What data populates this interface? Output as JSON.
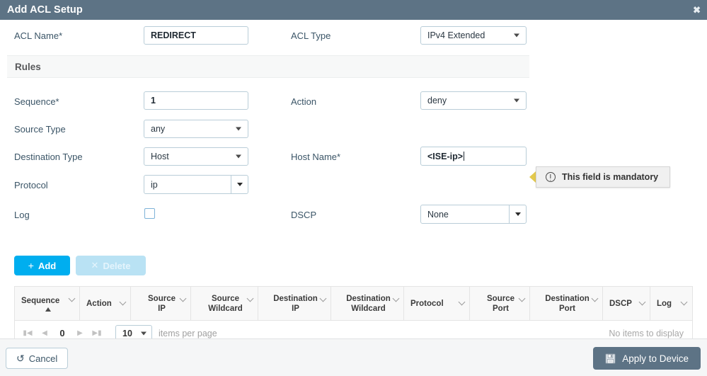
{
  "window": {
    "title": "Add ACL Setup",
    "close_icon": "close-icon"
  },
  "form": {
    "acl_name_label": "ACL Name*",
    "acl_name_value": "REDIRECT",
    "acl_type_label": "ACL Type",
    "acl_type_value": "IPv4 Extended",
    "rules_section_title": "Rules",
    "sequence_label": "Sequence*",
    "sequence_value": "1",
    "action_label": "Action",
    "action_value": "deny",
    "source_type_label": "Source Type",
    "source_type_value": "any",
    "destination_type_label": "Destination Type",
    "destination_type_value": "Host",
    "host_name_label": "Host Name*",
    "host_name_value": "<ISE-ip>",
    "protocol_label": "Protocol",
    "protocol_value": "ip",
    "log_label": "Log",
    "log_checked": false,
    "dscp_label": "DSCP",
    "dscp_value": "None"
  },
  "validation": {
    "message": "This field is mandatory",
    "icon": "exclamation-circle-icon",
    "pointer_color": "#e3c94e"
  },
  "rule_actions": {
    "add_label": "Add",
    "add_icon": "plus-icon",
    "delete_label": "Delete",
    "delete_icon": "close-x-icon",
    "delete_disabled": true
  },
  "grid": {
    "columns": [
      {
        "label": "Sequence",
        "lines": [
          "Sequence"
        ],
        "sorted": "asc",
        "width": 92
      },
      {
        "label": "Action",
        "lines": [
          "Action"
        ],
        "sorted": "none",
        "width": 72
      },
      {
        "label": "Source IP",
        "lines": [
          "Source",
          "IP"
        ],
        "sorted": "none",
        "width": 85
      },
      {
        "label": "Source Wildcard",
        "lines": [
          "Source",
          "Wildcard"
        ],
        "sorted": "none",
        "width": 95
      },
      {
        "label": "Destination IP",
        "lines": [
          "Destination",
          "IP"
        ],
        "sorted": "none",
        "width": 103
      },
      {
        "label": "Destination Wildcard",
        "lines": [
          "Destination",
          "Wildcard"
        ],
        "sorted": "none",
        "width": 103
      },
      {
        "label": "Protocol",
        "lines": [
          "Protocol"
        ],
        "sorted": "none",
        "width": 93
      },
      {
        "label": "Source Port",
        "lines": [
          "Source",
          "Port"
        ],
        "sorted": "none",
        "width": 85
      },
      {
        "label": "Destination Port",
        "lines": [
          "Destination",
          "Port"
        ],
        "sorted": "none",
        "width": 103
      },
      {
        "label": "DSCP",
        "lines": [
          "DSCP"
        ],
        "sorted": "none",
        "width": 67
      },
      {
        "label": "Log",
        "lines": [
          "Log"
        ],
        "sorted": "none",
        "width": 58
      }
    ],
    "rows": [],
    "empty_message": "No items to display"
  },
  "pagination": {
    "first_icon": "first-page-icon",
    "prev_icon": "previous-page-icon",
    "page_number": "0",
    "next_icon": "next-page-icon",
    "last_icon": "last-page-icon",
    "page_size": "10",
    "page_size_label": "items per page"
  },
  "footer": {
    "cancel_label": "Cancel",
    "cancel_icon": "undo-icon",
    "apply_label": "Apply to Device",
    "apply_icon": "save-floppy-icon"
  },
  "colors": {
    "titlebar": "#5d7385",
    "add_button": "#00aeef",
    "delete_button": "#b9e2f4",
    "apply_button": "#5d7385"
  }
}
